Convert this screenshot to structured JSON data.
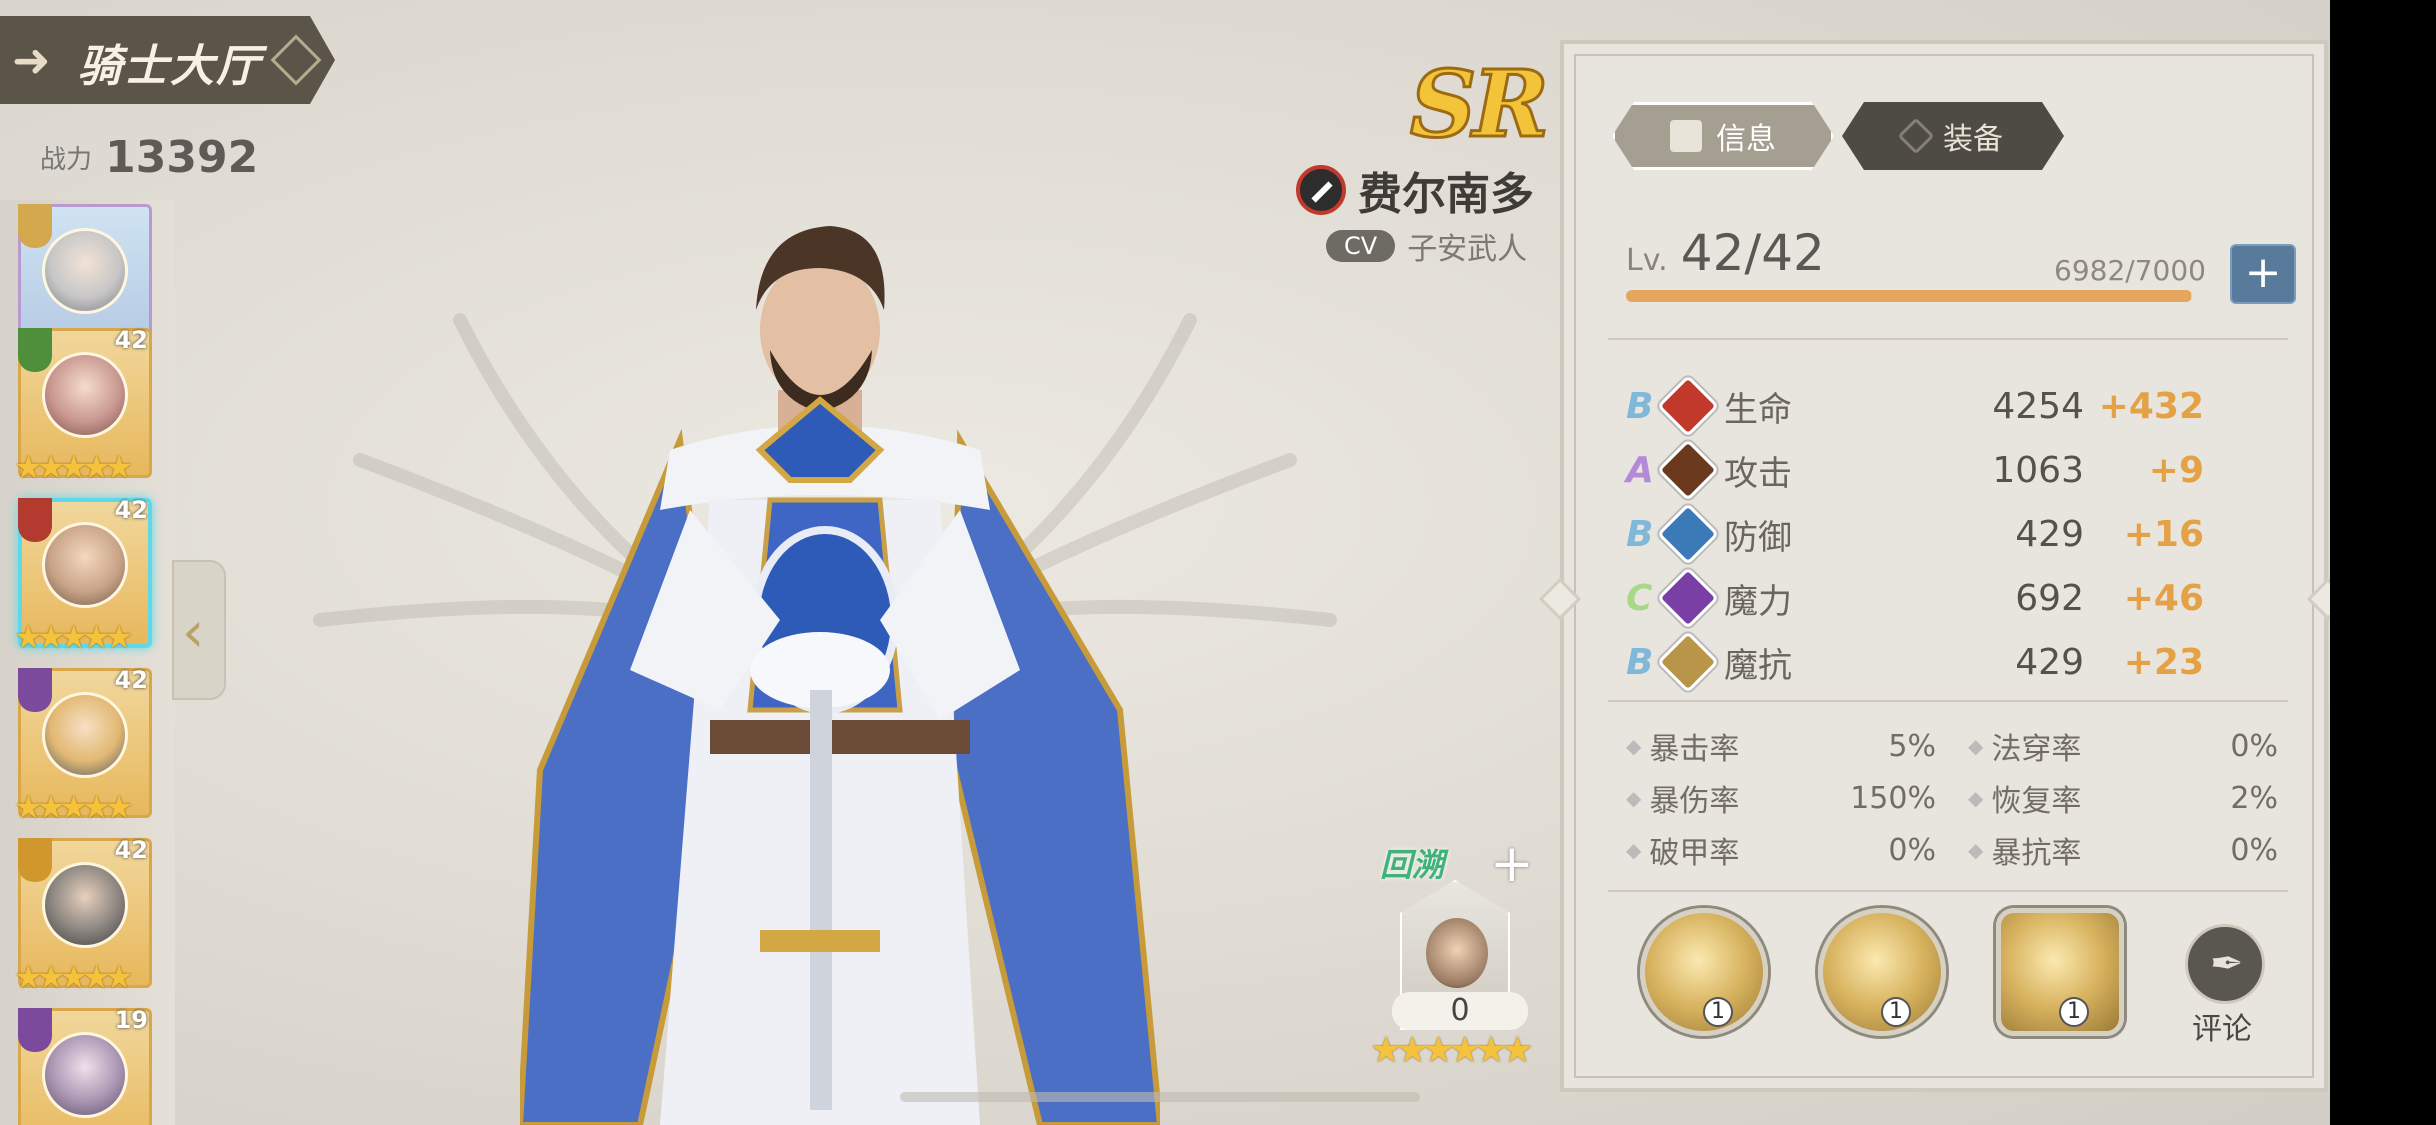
{
  "header": {
    "title": "骑士大厅"
  },
  "power": {
    "label": "战力",
    "value": "13392"
  },
  "roster": [
    {
      "level": "",
      "stars": "★★★",
      "class_color": "#d4a84c",
      "selected": false
    },
    {
      "level": "42",
      "stars": "★★★★★",
      "class_color": "#4f8f3c",
      "selected": false
    },
    {
      "level": "42",
      "stars": "★★★★★",
      "class_color": "#b33a2e",
      "selected": true
    },
    {
      "level": "42",
      "stars": "★★★★★",
      "class_color": "#7b4a9c",
      "selected": false
    },
    {
      "level": "42",
      "stars": "★★★★★",
      "class_color": "#d0972d",
      "selected": false
    },
    {
      "level": "19",
      "stars": "",
      "class_color": "#7b4a9c",
      "selected": false
    }
  ],
  "hero": {
    "rarity": "SR",
    "name": "费尔南多",
    "cv_tag": "CV",
    "cv_name": "子安武人"
  },
  "retro": {
    "label": "回溯",
    "count": "0",
    "stars": "★★★★★★"
  },
  "tabs": {
    "info": "信息",
    "equip": "装备"
  },
  "level": {
    "prefix": "Lv.",
    "value": "42/42",
    "exp": "6982/7000",
    "exp_fraction": 0.9974
  },
  "stats": [
    {
      "grade": "B",
      "grade_color": "#7fb8d8",
      "name": "生命",
      "value": "4254",
      "bonus": "+432",
      "icon_color": "#c0392b"
    },
    {
      "grade": "A",
      "grade_color": "#b48ad8",
      "name": "攻击",
      "value": "1063",
      "bonus": "+9",
      "icon_color": "#6b3a1e"
    },
    {
      "grade": "B",
      "grade_color": "#7fb8d8",
      "name": "防御",
      "value": "429",
      "bonus": "+16",
      "icon_color": "#3c7ab7"
    },
    {
      "grade": "C",
      "grade_color": "#a8d88a",
      "name": "魔力",
      "value": "692",
      "bonus": "+46",
      "icon_color": "#7a3fa5"
    },
    {
      "grade": "B",
      "grade_color": "#7fb8d8",
      "name": "魔抗",
      "value": "429",
      "bonus": "+23",
      "icon_color": "#b9954a"
    }
  ],
  "substats": [
    {
      "name": "暴击率",
      "value": "5%"
    },
    {
      "name": "法穿率",
      "value": "0%"
    },
    {
      "name": "暴伤率",
      "value": "150%"
    },
    {
      "name": "恢复率",
      "value": "2%"
    },
    {
      "name": "破甲率",
      "value": "0%"
    },
    {
      "name": "暴抗率",
      "value": "0%"
    }
  ],
  "skills": [
    {
      "level": "1"
    },
    {
      "level": "1"
    },
    {
      "level": "1"
    }
  ],
  "review": {
    "label": "评论"
  }
}
